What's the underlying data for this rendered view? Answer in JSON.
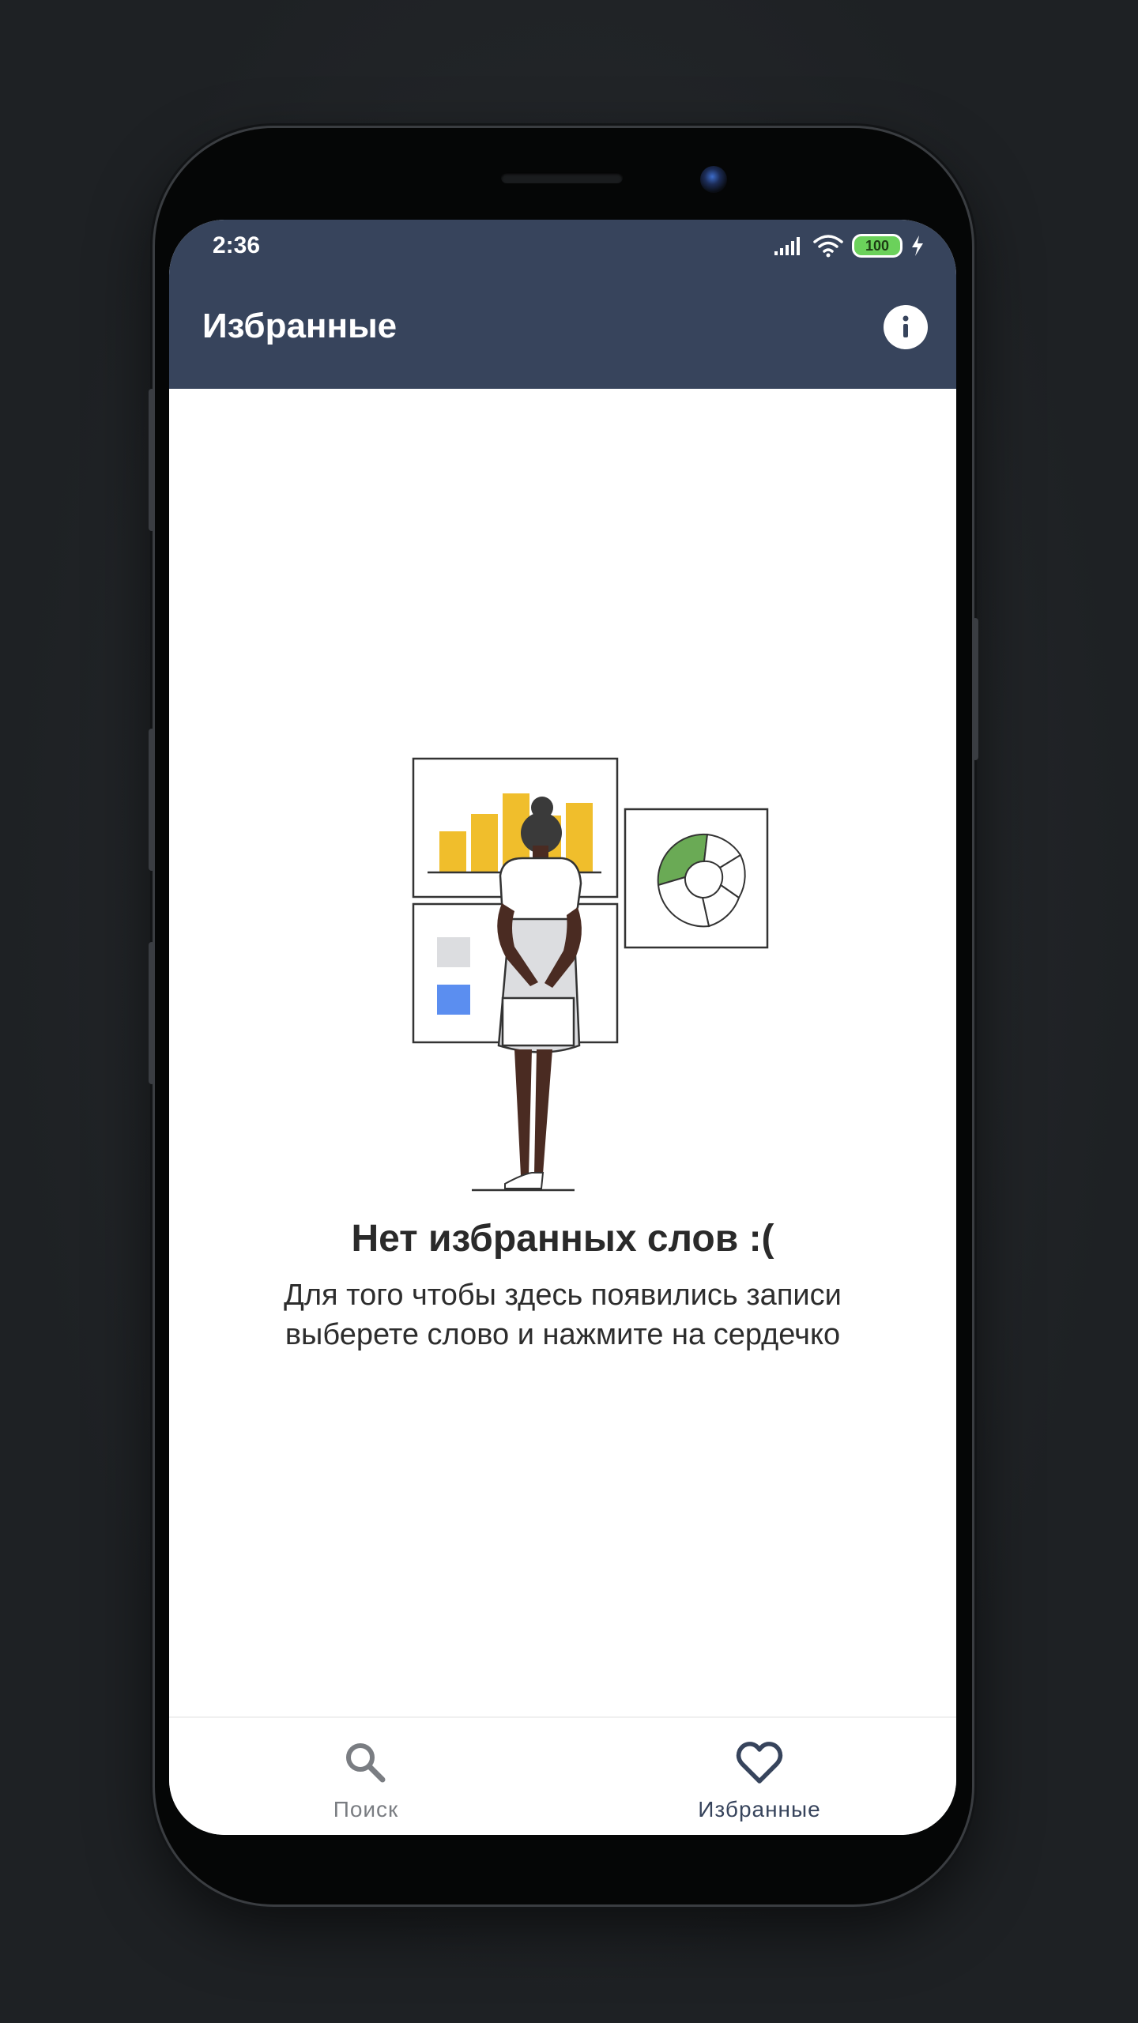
{
  "status_bar": {
    "time": "2:36",
    "battery": "100",
    "icons": [
      "signal-icon",
      "wifi-icon",
      "battery-icon",
      "charging-icon"
    ]
  },
  "app_bar": {
    "title": "Избранные",
    "action_icon": "info-icon"
  },
  "empty_state": {
    "illustration": "person-viewing-charts-illustration",
    "title": "Нет избранных слов :(",
    "description": "Для того чтобы здесь появились записи выберете слово и нажмите на сердечко"
  },
  "bottom_nav": {
    "items": [
      {
        "label": "Поиск",
        "icon": "search-icon",
        "active": false
      },
      {
        "label": "Избранные",
        "icon": "heart-icon",
        "active": true
      }
    ]
  },
  "colors": {
    "app_bar": "#37445c",
    "background": "#ffffff",
    "accent_yellow": "#f0be2c",
    "accent_green": "#6aaa55",
    "accent_blue": "#5b8ef0",
    "battery": "#6bd15b",
    "inactive_nav": "#7a7d82"
  }
}
